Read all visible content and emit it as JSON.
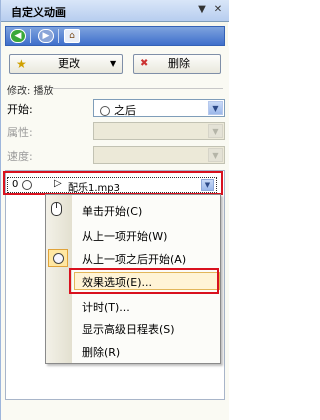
{
  "pane": {
    "title": "自定义动画",
    "dropdown_glyph": "▼",
    "close_glyph": "✕"
  },
  "nav": {
    "back_glyph": "◀",
    "forward_glyph": "▶",
    "home_glyph": "⌂"
  },
  "toolbar": {
    "change_label": "更改",
    "change_icon": "★",
    "change_arrow": "▼",
    "remove_label": "删除",
    "remove_icon": "✖"
  },
  "modify": {
    "section_label": "修改: 播放",
    "start_label": "开始:",
    "start_value": "之后",
    "property_label": "属性:",
    "speed_label": "速度:"
  },
  "list": {
    "selected_number": "0",
    "play_glyph": "▷",
    "selected_name": "配乐1.mp3",
    "dd_glyph": "▼"
  },
  "menu": {
    "items": [
      "单击开始(C)",
      "从上一项开始(W)",
      "从上一项之后开始(A)",
      "效果选项(E)...",
      "计时(T)...",
      "显示高级日程表(S)",
      "删除(R)"
    ]
  },
  "colors": {
    "highlight_frame": "#d9111e",
    "menu_hover": "#fff4d6"
  }
}
